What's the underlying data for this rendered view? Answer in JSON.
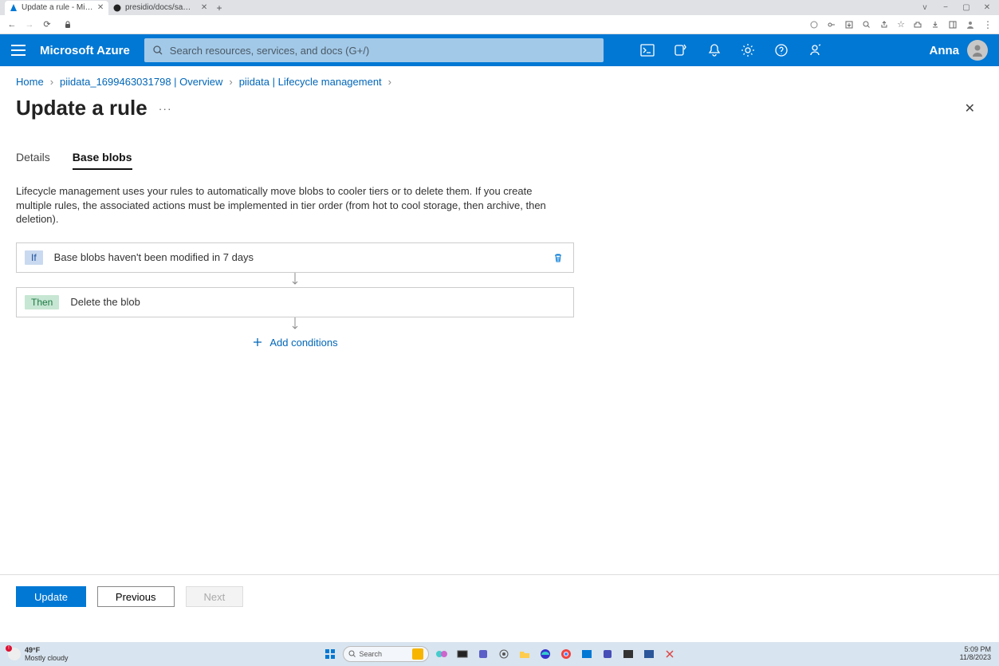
{
  "browser": {
    "tabs": [
      {
        "title": "Update a rule - Microsoft Azure",
        "active": true
      },
      {
        "title": "presidio/docs/samples/deploy",
        "active": false
      }
    ]
  },
  "window": {
    "min": "v",
    "restore": "−",
    "max": "▢",
    "close": "✕"
  },
  "azure": {
    "brand": "Microsoft Azure",
    "search_placeholder": "Search resources, services, and docs (G+/)",
    "user": "Anna"
  },
  "breadcrumb": [
    "Home",
    "piidata_1699463031798 | Overview",
    "piidata | Lifecycle management"
  ],
  "page": {
    "title": "Update a rule",
    "more": "···"
  },
  "tabs": {
    "details": "Details",
    "base_blobs": "Base blobs"
  },
  "description": "Lifecycle management uses your rules to automatically move blobs to cooler tiers or to delete them. If you create multiple rules, the associated actions must be implemented in tier order (from hot to cool storage, then archive, then deletion).",
  "rule": {
    "if_badge": "If",
    "if_text": "Base blobs haven't been modified in 7 days",
    "then_badge": "Then",
    "then_text": "Delete the blob",
    "add_conditions": "Add conditions"
  },
  "footer": {
    "update": "Update",
    "previous": "Previous",
    "next": "Next"
  },
  "taskbar": {
    "temp": "49°F",
    "weather": "Mostly cloudy",
    "search": "Search",
    "time": "5:09 PM",
    "date": "11/8/2023"
  }
}
